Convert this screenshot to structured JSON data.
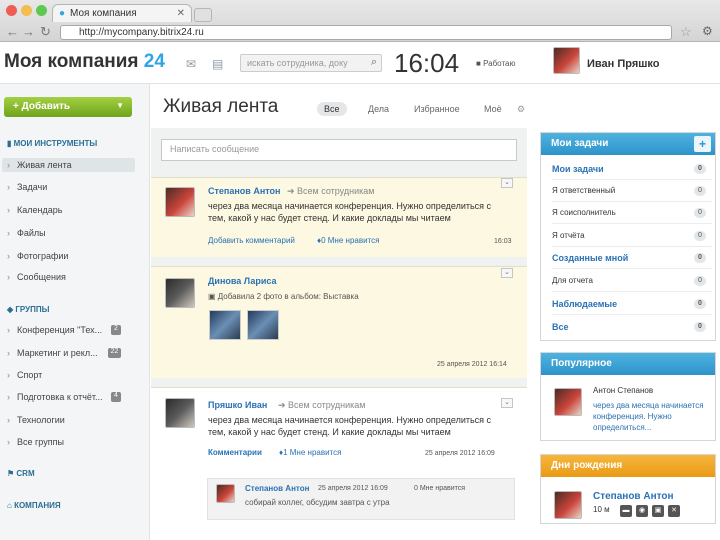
{
  "browser": {
    "tab_title": "Моя компания",
    "url": "http://mycompany.bitrix24.ru"
  },
  "header": {
    "logo_text": "Моя компания",
    "logo_num": "24",
    "search_placeholder": "искать сотрудника, доку",
    "clock": "16:04",
    "status": "Работаю",
    "user_name": "Иван Пряшко"
  },
  "sidebar": {
    "add_label": "Добавить",
    "tools_title": "МОИ ИНСТРУМЕНТЫ",
    "tools": [
      "Живая лента",
      "Задачи",
      "Календарь",
      "Файлы",
      "Фотографии",
      "Сообщения"
    ],
    "groups_title": "ГРУППЫ",
    "groups": [
      {
        "label": "Конференция \"Тех...",
        "badge": "2"
      },
      {
        "label": "Маркетинг и рекл...",
        "badge": "22"
      },
      {
        "label": "Спорт",
        "badge": ""
      },
      {
        "label": "Подготовка к отчёт...",
        "badge": "4"
      },
      {
        "label": "Технологии",
        "badge": ""
      },
      {
        "label": "Все группы",
        "badge": ""
      }
    ],
    "crm_title": "CRM",
    "company_title": "КОМПАНИЯ"
  },
  "main": {
    "title": "Живая лента",
    "filters": [
      "Все",
      "Дела",
      "Избранное",
      "Моё"
    ],
    "compose_placeholder": "Написать сообщение"
  },
  "posts": [
    {
      "author": "Степанов Антон",
      "target": "Всем сотрудникам",
      "text": "через два месяца начинается конференция. Нужно определиться с тем, какой у нас будет стенд. И какие доклады мы читаем",
      "comment_link": "Добавить комментарий",
      "likes": "0 Мне нравится",
      "time": "16:03"
    },
    {
      "author": "Динова Лариса",
      "action": "Добавила 2 фото в альбом: Выставка",
      "time": "25 апреля 2012 16:14"
    },
    {
      "author": "Пряшко Иван",
      "target": "Всем сотрудникам",
      "text": "через два месяца начинается конференция. Нужно определиться с тем, какой у нас будет стенд. И какие доклады мы читаем",
      "comments_label": "Комментарии",
      "likes": "1 Мне нравится",
      "time": "25 апреля 2012 16:09",
      "comment": {
        "author": "Степанов Антон",
        "time": "25 апреля 2012 16:09",
        "likes": "0 Мне нравится",
        "text": "собирай коллег, обсудим завтра с утра"
      }
    }
  ],
  "tasks": {
    "title": "Мои задачи",
    "items": [
      {
        "label": "Мои задачи",
        "count": "0",
        "bold": true
      },
      {
        "label": "Я ответственный",
        "count": "0",
        "bold": false
      },
      {
        "label": "Я соисполнитель",
        "count": "0",
        "bold": false
      },
      {
        "label": "Я отчёта",
        "count": "0",
        "bold": false
      },
      {
        "label": "Созданные мной",
        "count": "0",
        "bold": true
      },
      {
        "label": "Для отчета",
        "count": "0",
        "bold": false
      },
      {
        "label": "Наблюдаемые",
        "count": "0",
        "bold": true
      },
      {
        "label": "Все",
        "count": "0",
        "bold": true
      }
    ]
  },
  "popular": {
    "title": "Популярное",
    "author": "Антон Степанов",
    "text": "через два месяца начинается конференция. Нужно определиться..."
  },
  "birthdays": {
    "title": "Дни рождения",
    "name": "Степанов Антон",
    "date": "10 м"
  },
  "colors": {
    "accent": "#2fa4e7",
    "add_button": "#8bc03a",
    "post_bg": "#fdf8e1",
    "birthday_header": "#f0a628"
  }
}
